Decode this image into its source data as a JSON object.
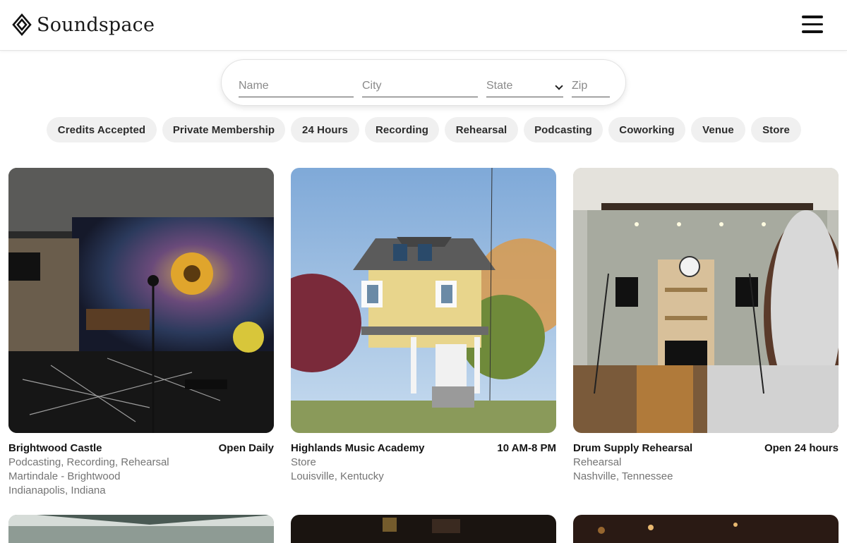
{
  "brand": {
    "name": "Soundspace"
  },
  "search": {
    "name_placeholder": "Name",
    "city_placeholder": "City",
    "state_label": "State",
    "zip_placeholder": "Zip"
  },
  "filters": [
    "Credits Accepted",
    "Private Membership",
    "24 Hours",
    "Recording",
    "Rehearsal",
    "Podcasting",
    "Coworking",
    "Venue",
    "Store"
  ],
  "listings": [
    {
      "name": "Brightwood Castle",
      "hours": "Open Daily",
      "categories": "Podcasting, Recording, Rehearsal",
      "neighborhood": "Martindale - Brightwood",
      "location": "Indianapolis, Indiana"
    },
    {
      "name": "Highlands Music Academy",
      "hours": "10 AM-8 PM",
      "categories": "Store",
      "location": "Louisville, Kentucky"
    },
    {
      "name": "Drum Supply Rehearsal",
      "hours": "Open 24 hours",
      "categories": "Rehearsal",
      "location": "Nashville, Tennessee"
    }
  ],
  "colors": {
    "chip_bg": "#f0f0f0",
    "text": "#1a1a1a",
    "muted": "#747474"
  }
}
